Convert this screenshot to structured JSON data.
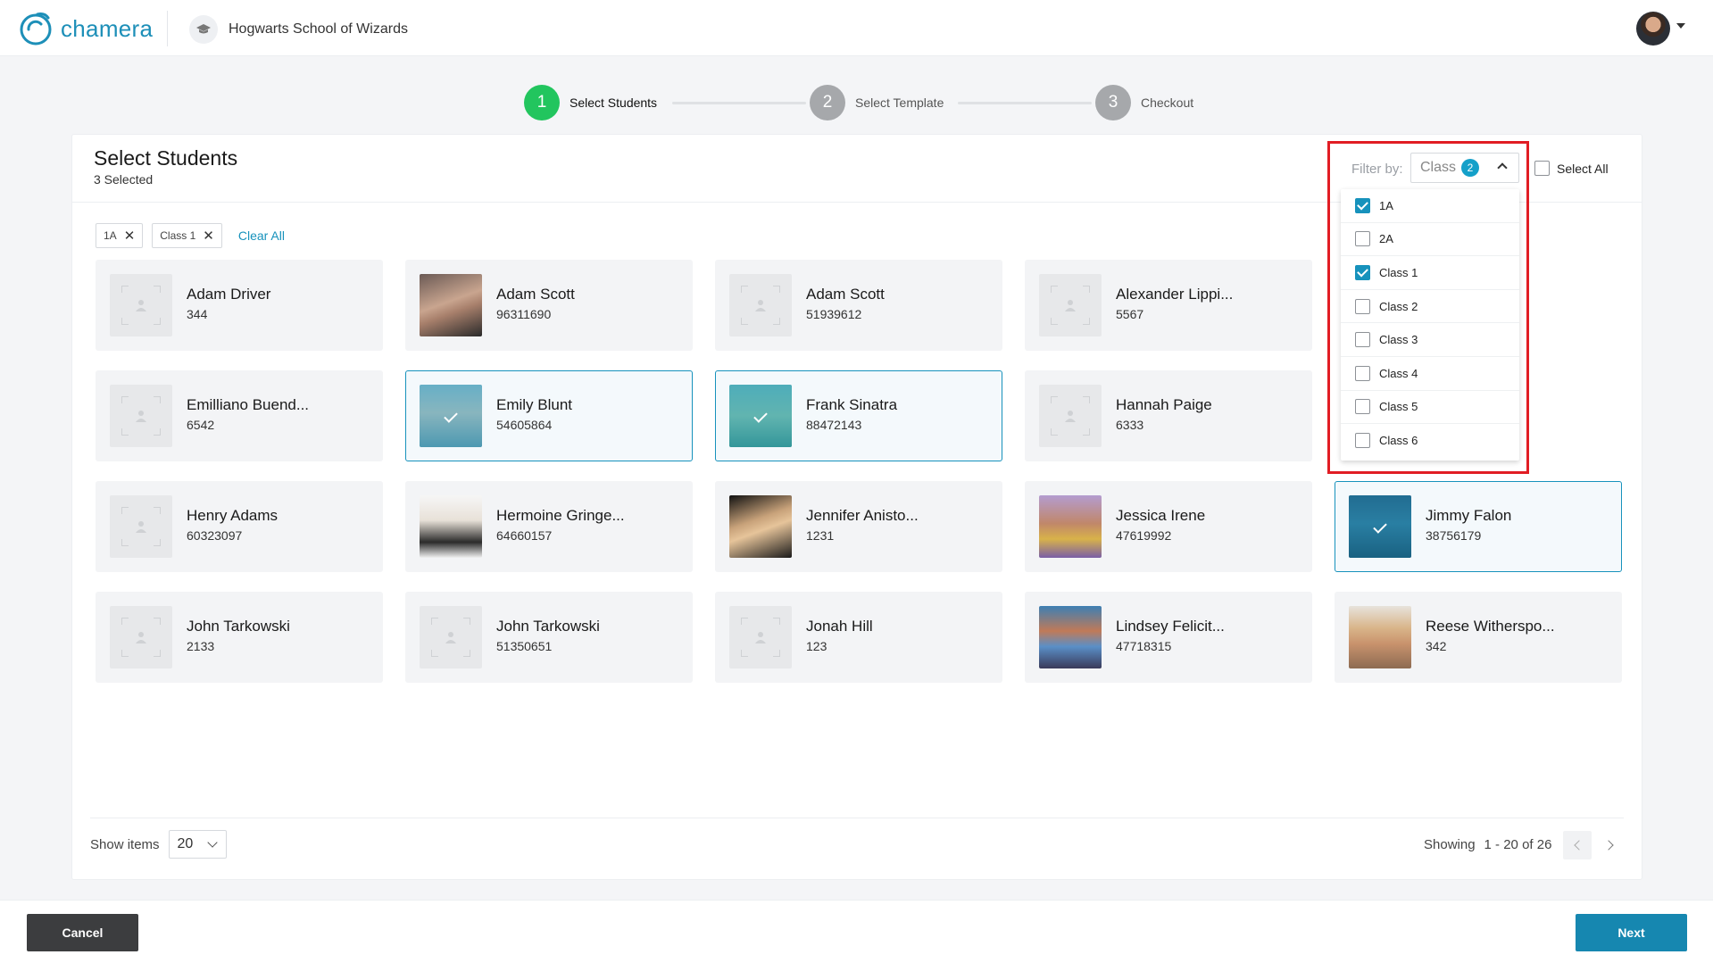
{
  "app": {
    "name": "chamera",
    "school": "Hogwarts School of Wizards"
  },
  "steps": [
    {
      "number": "1",
      "label": "Select Students",
      "active": true
    },
    {
      "number": "2",
      "label": "Select Template",
      "active": false
    },
    {
      "number": "3",
      "label": "Checkout",
      "active": false
    }
  ],
  "panel": {
    "title": "Select Students",
    "subtitle": "3 Selected"
  },
  "filter": {
    "label": "Filter by:",
    "select_value": "Class",
    "count": "2",
    "select_all_label": "Select All"
  },
  "chips": [
    {
      "label": "1A"
    },
    {
      "label": "Class 1"
    }
  ],
  "clear_all": "Clear All",
  "students": [
    {
      "name": "Adam Driver",
      "id": "344",
      "photo": "none",
      "selected": false
    },
    {
      "name": "Adam Scott",
      "id": "96311690",
      "photo": "a",
      "selected": false
    },
    {
      "name": "Adam Scott",
      "id": "51939612",
      "photo": "none",
      "selected": false
    },
    {
      "name": "Alexander Lippi...",
      "id": "5567",
      "photo": "none",
      "selected": false
    },
    {
      "name": "Emilliano Buend...",
      "id": "6542",
      "photo": "none",
      "selected": false
    },
    {
      "name": "Emily Blunt",
      "id": "54605864",
      "photo": "b",
      "selected": true
    },
    {
      "name": "Frank Sinatra",
      "id": "88472143",
      "photo": "c",
      "selected": true
    },
    {
      "name": "Hannah Paige",
      "id": "6333",
      "photo": "none",
      "selected": false
    },
    {
      "name": "Henry Adams",
      "id": "60323097",
      "photo": "none",
      "selected": false
    },
    {
      "name": "Hermoine Gringe...",
      "id": "64660157",
      "photo": "d",
      "selected": false
    },
    {
      "name": "Jennifer Anisto...",
      "id": "1231",
      "photo": "e",
      "selected": false
    },
    {
      "name": "Jessica Irene",
      "id": "47619992",
      "photo": "f",
      "selected": false
    },
    {
      "name": "Jimmy Falon",
      "id": "38756179",
      "photo": "i",
      "selected": true
    },
    {
      "name": "John Tarkowski",
      "id": "2133",
      "photo": "none",
      "selected": false
    },
    {
      "name": "John Tarkowski",
      "id": "51350651",
      "photo": "none",
      "selected": false
    },
    {
      "name": "Jonah Hill",
      "id": "123",
      "photo": "none",
      "selected": false
    },
    {
      "name": "Lindsey Felicit...",
      "id": "47718315",
      "photo": "g",
      "selected": false
    },
    {
      "name": "Reese Witherspo...",
      "id": "342",
      "photo": "h",
      "selected": false
    }
  ],
  "dropdown_options": [
    {
      "label": "1A",
      "checked": true
    },
    {
      "label": "2A",
      "checked": false
    },
    {
      "label": "Class 1",
      "checked": true
    },
    {
      "label": "Class 2",
      "checked": false
    },
    {
      "label": "Class 3",
      "checked": false
    },
    {
      "label": "Class 4",
      "checked": false
    },
    {
      "label": "Class 5",
      "checked": false
    },
    {
      "label": "Class 6",
      "checked": false
    }
  ],
  "pagination": {
    "show_items_label": "Show items",
    "per_page": "20",
    "showing_label": "Showing",
    "range": "1 - 20 of 26"
  },
  "actions": {
    "cancel": "Cancel",
    "next": "Next"
  },
  "colors": {
    "accent": "#1792bc",
    "active_step": "#22c55e",
    "highlight": "#e11d24"
  }
}
